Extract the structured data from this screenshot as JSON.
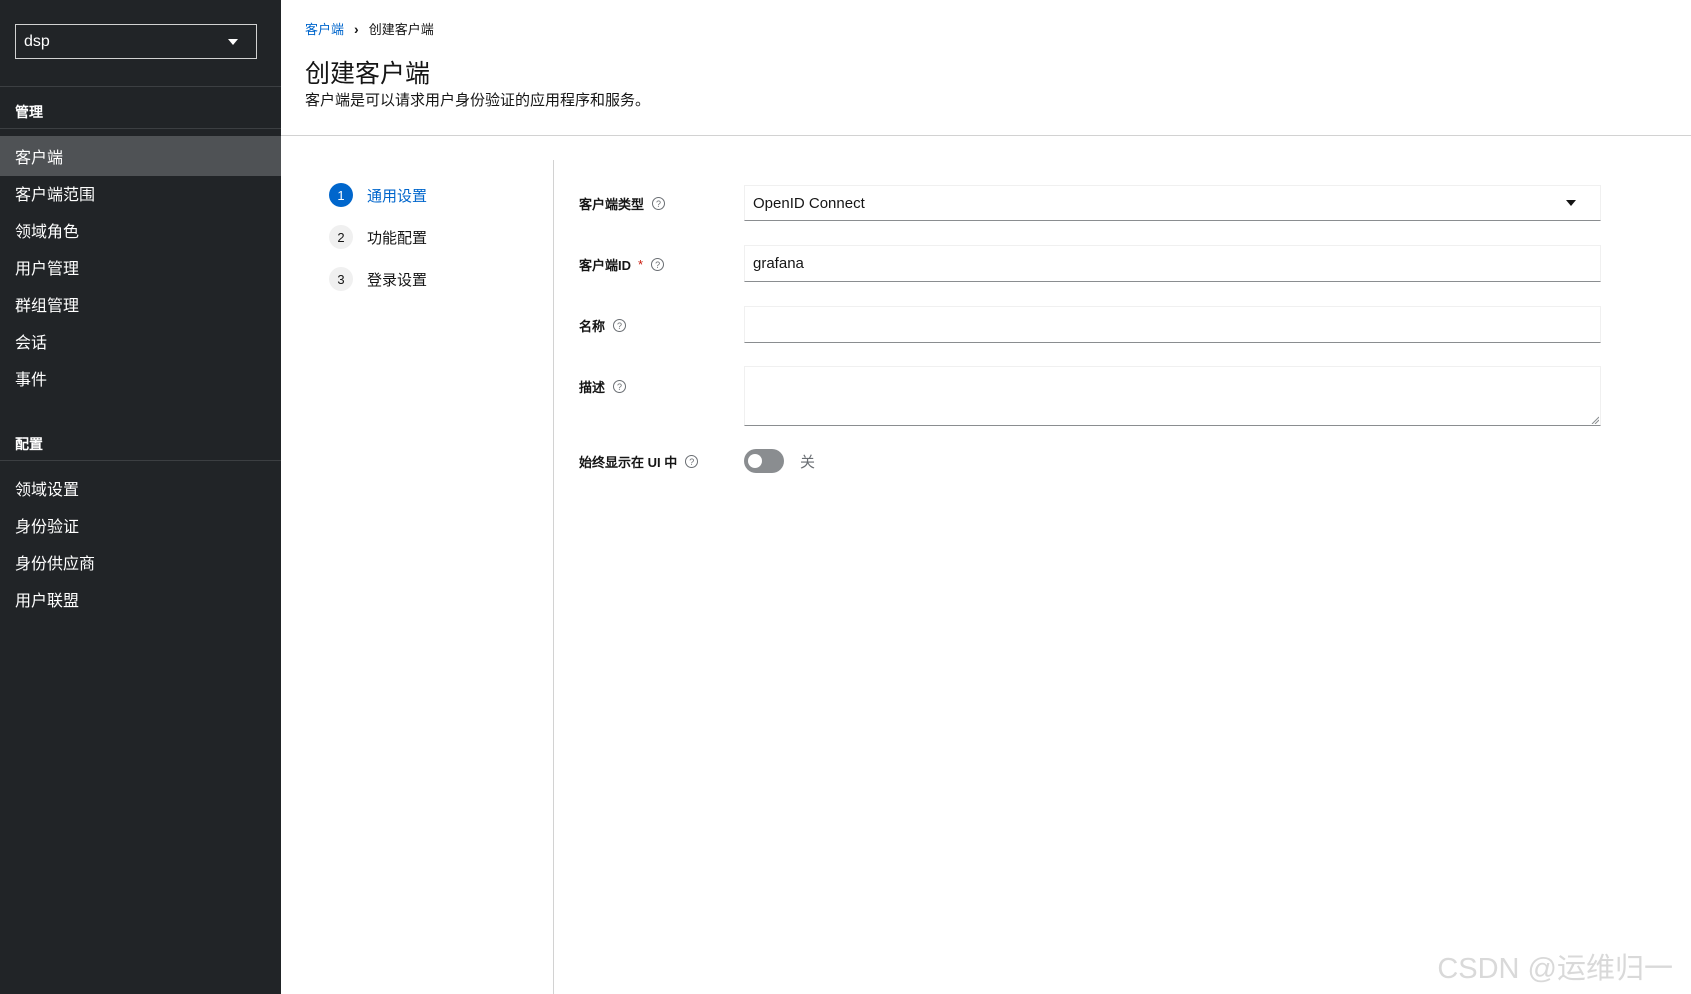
{
  "sidebar": {
    "realm_select": "dsp",
    "groups": [
      {
        "title": "管理",
        "items": [
          "客户端",
          "客户端范围",
          "领域角色",
          "用户管理",
          "群组管理",
          "会话",
          "事件"
        ]
      },
      {
        "title": "配置",
        "items": [
          "领域设置",
          "身份验证",
          "身份供应商",
          "用户联盟"
        ]
      }
    ],
    "active_item": "客户端"
  },
  "breadcrumb": {
    "link": "客户端",
    "separator": "›",
    "current": "创建客户端"
  },
  "header": {
    "title": "创建客户端",
    "description": "客户端是可以请求用户身份验证的应用程序和服务。"
  },
  "wizard": {
    "steps": [
      {
        "num": "1",
        "label": "通用设置"
      },
      {
        "num": "2",
        "label": "功能配置"
      },
      {
        "num": "3",
        "label": "登录设置"
      }
    ],
    "current_step": 1
  },
  "form": {
    "client_type": {
      "label": "客户端类型",
      "value": "OpenID Connect"
    },
    "client_id": {
      "label": "客户端ID",
      "required_mark": "*",
      "value": "grafana"
    },
    "name": {
      "label": "名称",
      "value": ""
    },
    "description": {
      "label": "描述",
      "value": ""
    },
    "always_display": {
      "label": "始终显示在 UI 中",
      "state_label": "关"
    }
  },
  "icons": {
    "help": "?"
  },
  "watermark": "CSDN @运维归一"
}
